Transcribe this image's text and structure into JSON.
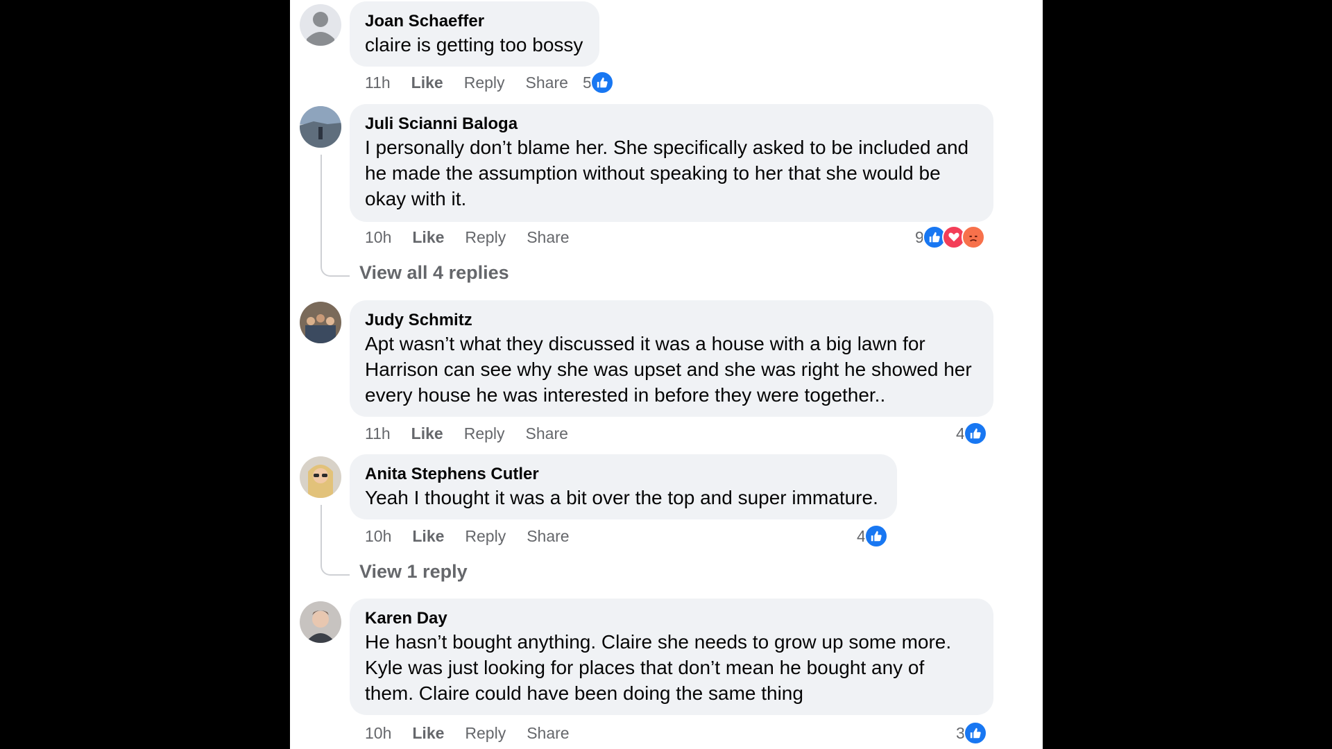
{
  "comments": [
    {
      "author": "Joan Schaeffer",
      "text": "claire is getting too bossy",
      "time": "11h",
      "like": "Like",
      "reply": "Reply",
      "share": "Share",
      "reaction_count": "5",
      "reactions": [
        "like-icon"
      ]
    },
    {
      "author": "Juli Scianni Baloga",
      "text": "I personally don’t blame her. She specifically asked to be included and he made the assumption without speaking to her that she would be okay with it.",
      "time": "10h",
      "like": "Like",
      "reply": "Reply",
      "share": "Share",
      "reaction_count": "9",
      "reactions": [
        "like-icon",
        "love-icon",
        "angry-icon"
      ],
      "view_replies": "View all 4 replies"
    },
    {
      "author": "Judy Schmitz",
      "text": "Apt wasn’t what they discussed it was a house with a big lawn for Harrison can see why she was upset and she was right he showed her every house he was interested in before they were together..",
      "time": "11h",
      "like": "Like",
      "reply": "Reply",
      "share": "Share",
      "reaction_count": "4",
      "reactions": [
        "like-icon"
      ]
    },
    {
      "author": "Anita Stephens Cutler",
      "text": "Yeah I thought it was a bit over the top and super immature.",
      "time": "10h",
      "like": "Like",
      "reply": "Reply",
      "share": "Share",
      "reaction_count": "4",
      "reactions": [
        "like-icon"
      ],
      "view_replies": "View 1 reply"
    },
    {
      "author": "Karen Day",
      "text": "He hasn’t bought anything. Claire she needs to grow up some more. Kyle was just looking for places that don’t mean he bought any of them. Claire could have been doing the same thing",
      "time": "10h",
      "like": "Like",
      "reply": "Reply",
      "share": "Share",
      "reaction_count": "3",
      "reactions": [
        "like-icon"
      ]
    }
  ],
  "colors": {
    "bubble": "#f0f2f5",
    "meta_text": "#65676b",
    "like": "#1877f2",
    "love": "#f33e58",
    "angry": "#f7714b"
  }
}
